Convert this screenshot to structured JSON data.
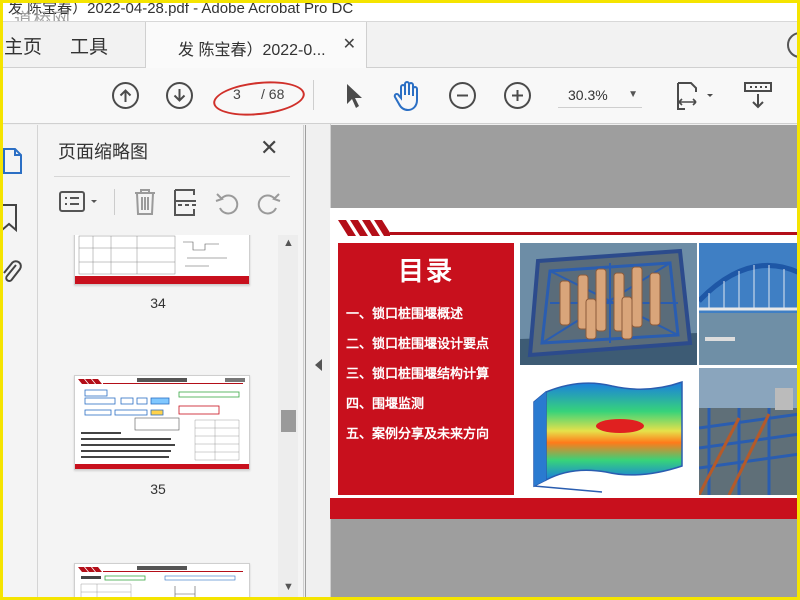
{
  "titlebar": {
    "title": "发 陈宝春）2022-04-28.pdf - Adobe Acrobat Pro DC",
    "watermark": "道桥网"
  },
  "tabs": {
    "home": "主页",
    "tools": "工具",
    "document": "发 陈宝春）2022-0...",
    "close": "✕"
  },
  "toolbar": {
    "current_page": "3",
    "total_pages": "/ 68",
    "zoom": "30.3%",
    "icons": [
      "arrow-up-circle",
      "arrow-down-circle",
      "select-arrow",
      "hand-tool",
      "zoom-out",
      "zoom-in",
      "page-fit",
      "scroll-mode"
    ]
  },
  "panel": {
    "title": "页面缩略图",
    "close": "✕",
    "thumbnails": [
      {
        "page": "34"
      },
      {
        "page": "35"
      },
      {
        "page": ""
      }
    ]
  },
  "slide": {
    "heading": "目录",
    "items": [
      "一、锁口桩围堰概述",
      "二、锁口桩围堰设计要点",
      "三、锁口桩围堰结构计算",
      "四、围堰监测",
      "五、案例分享及未来方向"
    ]
  },
  "colors": {
    "accent_red": "#c8101d",
    "frame_yellow": "#f5e400",
    "annotation_red": "#d0302a",
    "doc_background": "#9e9e9e"
  }
}
